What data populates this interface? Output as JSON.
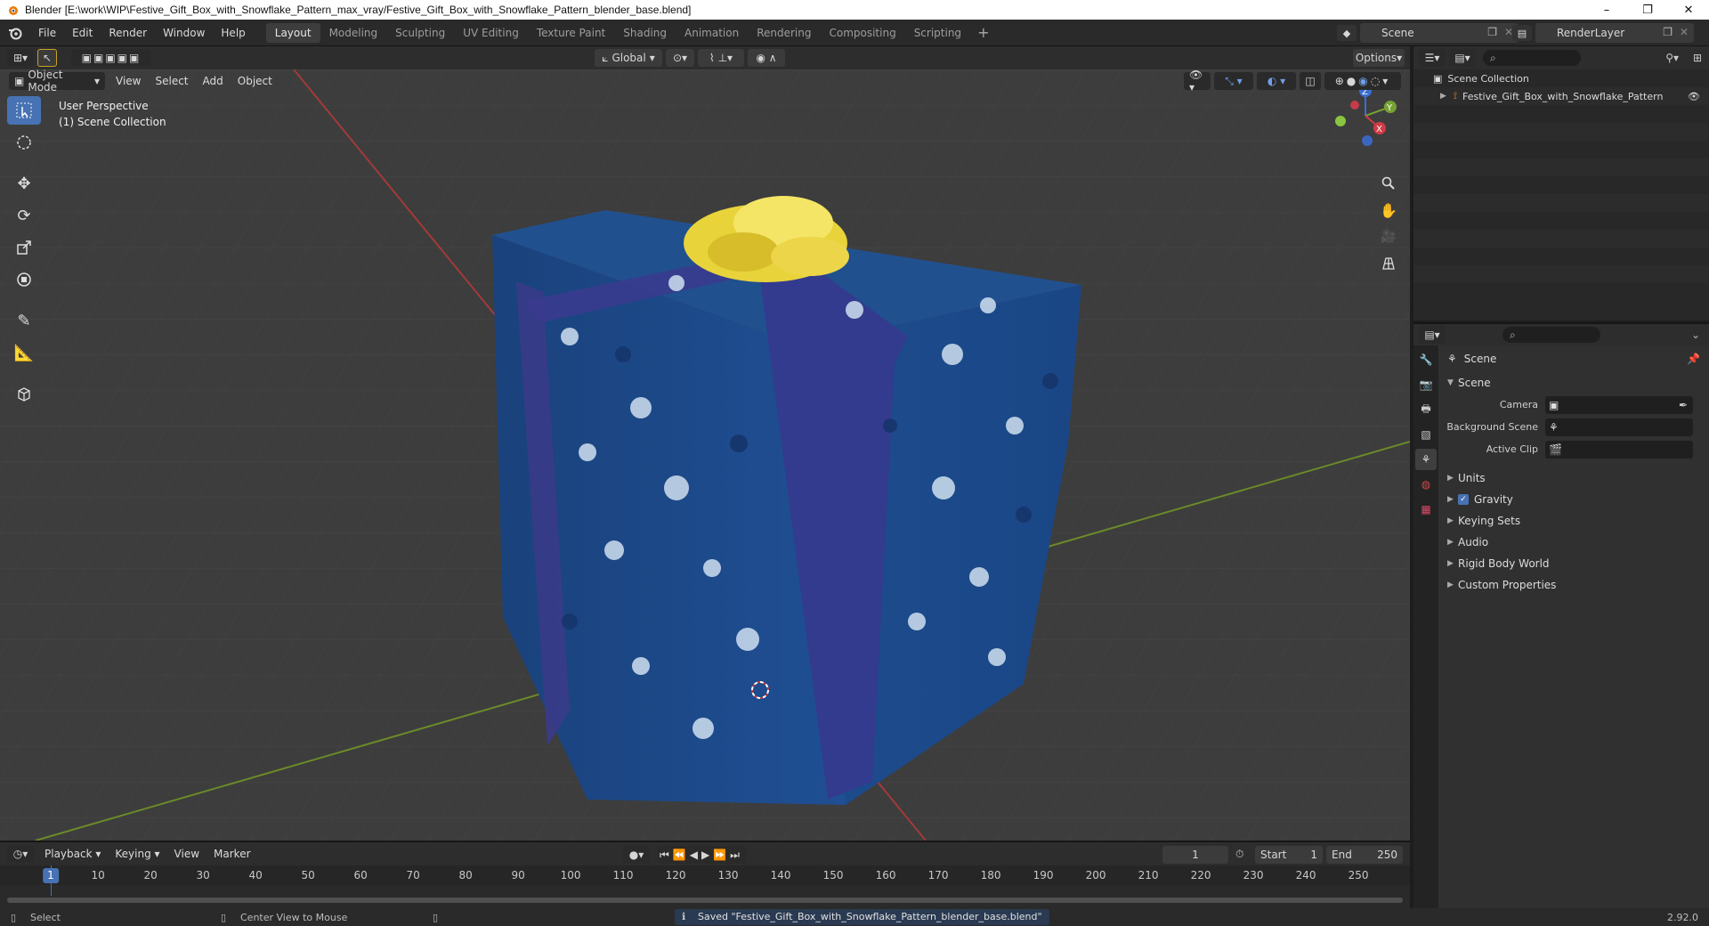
{
  "window": {
    "title": "Blender [E:\\work\\WIP\\Festive_Gift_Box_with_Snowflake_Pattern_max_vray/Festive_Gift_Box_with_Snowflake_Pattern_blender_base.blend]",
    "minimize": "–",
    "maximize": "❐",
    "close": "✕"
  },
  "menu": [
    "File",
    "Edit",
    "Render",
    "Window",
    "Help"
  ],
  "workspaces": [
    "Layout",
    "Modeling",
    "Sculpting",
    "UV Editing",
    "Texture Paint",
    "Shading",
    "Animation",
    "Rendering",
    "Compositing",
    "Scripting"
  ],
  "active_workspace": "Layout",
  "scene_name": "Scene",
  "render_layer": "RenderLayer",
  "viewport": {
    "mode": "Object Mode",
    "menus": [
      "View",
      "Select",
      "Add",
      "Object"
    ],
    "orientation": "Global",
    "options_label": "Options",
    "info_line1": "User Perspective",
    "info_line2": "(1) Scene Collection",
    "gizmo_labels": {
      "x": "X",
      "y": "Y",
      "z": "Z"
    }
  },
  "outliner": {
    "root": "Scene Collection",
    "items": [
      "Festive_Gift_Box_with_Snowflake_Pattern"
    ]
  },
  "properties": {
    "context_title": "Scene",
    "panel_scene": "Scene",
    "fields": [
      {
        "label": "Camera",
        "value": ""
      },
      {
        "label": "Background Scene",
        "value": ""
      },
      {
        "label": "Active Clip",
        "value": ""
      }
    ],
    "subpanels": [
      "Units",
      "Gravity",
      "Keying Sets",
      "Audio",
      "Rigid Body World",
      "Custom Properties"
    ],
    "gravity_checked": true
  },
  "timeline": {
    "menus": [
      "Playback",
      "Keying",
      "View",
      "Marker"
    ],
    "current_frame": "1",
    "start_label": "Start",
    "start": "1",
    "end_label": "End",
    "end": "250",
    "ruler": [
      "10",
      "20",
      "30",
      "40",
      "50",
      "60",
      "70",
      "80",
      "90",
      "100",
      "110",
      "120",
      "130",
      "140",
      "150",
      "160",
      "170",
      "180",
      "190",
      "200",
      "210",
      "220",
      "230",
      "240",
      "250"
    ]
  },
  "statusbar": {
    "left": "Select",
    "middle": "Center View to Mouse",
    "message": "Saved \"Festive_Gift_Box_with_Snowflake_Pattern_blender_base.blend\"",
    "version": "2.92.0"
  },
  "colors": {
    "accent": "#4772b3",
    "box_blue": "#1c4a8c",
    "ribbon": "#3a3a8c",
    "bow": "#f2e04a"
  }
}
